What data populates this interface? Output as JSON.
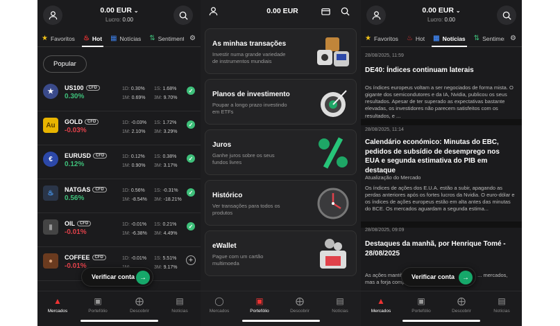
{
  "screen1": {
    "balance": "0.00 EUR",
    "profit_label": "Lucro:",
    "profit_value": "0.00",
    "tabs": [
      {
        "icon": "star-icon",
        "label": "Favoritos"
      },
      {
        "icon": "flame-icon",
        "label": "Hot"
      },
      {
        "icon": "news-icon",
        "label": "Notícias"
      },
      {
        "icon": "sentiment-icon",
        "label": "Sentimento"
      }
    ],
    "filter_pill": "Popular",
    "instruments": [
      {
        "symbol": "US100",
        "badge": "CFD",
        "change": "0.30%",
        "d1": "0.30%",
        "w1": "1.68%",
        "m1": "0.69%",
        "m3": "9.70%",
        "added": true,
        "logo": "us-flag"
      },
      {
        "symbol": "GOLD",
        "badge": "CFD",
        "change": "-0.03%",
        "d1": "-0.03%",
        "w1": "1.72%",
        "m1": "2.10%",
        "m3": "3.29%",
        "added": true,
        "logo": "Au"
      },
      {
        "symbol": "EURUSD",
        "badge": "CFD",
        "change": "0.12%",
        "d1": "0.12%",
        "w1": "0.38%",
        "m1": "0.90%",
        "m3": "3.17%",
        "added": true,
        "logo": "eu-us-flag"
      },
      {
        "symbol": "NATGAS",
        "badge": "CFD",
        "change": "0.56%",
        "d1": "0.56%",
        "w1": "-0.31%",
        "m1": "-8.54%",
        "m3": "-18.21%",
        "added": true,
        "logo": "flame"
      },
      {
        "symbol": "OIL",
        "badge": "CFD",
        "change": "-0.01%",
        "d1": "-0.01%",
        "w1": "0.21%",
        "m1": "-6.38%",
        "m3": "4.49%",
        "added": true,
        "logo": "barrel"
      },
      {
        "symbol": "COFFEE",
        "badge": "CFD",
        "change": "-0.01%",
        "d1": "-0.01%",
        "w1": "5.51%",
        "m1": "",
        "m3": "9.17%",
        "added": false,
        "logo": "coffee-bean"
      }
    ],
    "period_labels": {
      "d1": "1D:",
      "w1": "1S:",
      "m1": "1M:",
      "m3": "3M:"
    },
    "verify_button": "Verificar conta",
    "nav": [
      {
        "label": "Mercados",
        "icon": "markets-icon",
        "active": true
      },
      {
        "label": "Portefólio",
        "icon": "wallet-icon",
        "active": false
      },
      {
        "label": "Descobrir",
        "icon": "compass-icon",
        "active": false
      },
      {
        "label": "Notícias",
        "icon": "newspaper-icon",
        "active": false
      }
    ]
  },
  "screen2": {
    "balance": "0.00 EUR",
    "cards": [
      {
        "title": "As minhas transações",
        "subtitle": "Investir numa grande variedade de instrumentos mundiais",
        "art": "stocks-art"
      },
      {
        "title": "Planos de investimento",
        "subtitle": "Poupar a longo prazo investindo em ETFs",
        "art": "target-art"
      },
      {
        "title": "Juros",
        "subtitle": "Ganhe juros sobre os seus fundos livres",
        "art": "percent-art"
      },
      {
        "title": "Histórico",
        "subtitle": "Ver transações para todos os produtos",
        "art": "clock-art"
      },
      {
        "title": "eWallet",
        "subtitle": "Pague com um cartão multimoeda",
        "art": "wallet-art"
      }
    ],
    "nav": [
      {
        "label": "Mercados",
        "icon": "markets-icon",
        "active": false
      },
      {
        "label": "Portefólio",
        "icon": "wallet-icon",
        "active": true
      },
      {
        "label": "Descobrir",
        "icon": "compass-icon",
        "active": false
      },
      {
        "label": "Notícias",
        "icon": "newspaper-icon",
        "active": false
      }
    ]
  },
  "screen3": {
    "balance": "0.00 EUR",
    "profit_label": "Lucro:",
    "profit_value": "0.00",
    "tabs": [
      {
        "icon": "star-icon",
        "label": "Favoritos"
      },
      {
        "icon": "flame-icon",
        "label": "Hot"
      },
      {
        "icon": "news-icon",
        "label": "Notícias"
      },
      {
        "icon": "sentiment-icon",
        "label": "Sentimento"
      }
    ],
    "news": [
      {
        "date": "28/08/2025, 11:59",
        "title": "DE40: Índices continuam laterais",
        "body": "Os índices europeus voltam a ser negociados de forma mista. O gigante dos semicondutores e da IA, Nvidia, publicou os seus resultados. Apesar de ter superado as expectativas bastante elevadas, os investidores não parecem satisfeitos com os resultados, e ..."
      },
      {
        "date": "28/08/2025, 11:14",
        "title": "Calendário económico: Minutas do EBC, pedidos de subsídio de desemprego nos EUA e segunda estimativa do PIB em destaque",
        "subhead": "Atualização do Mercado",
        "body": "Os índices de ações dos E.U.A. estão a subir, apagando as perdas anteriores após os fortes lucros da Nvidia. O euro-dólar e os índices de ações europeus estão em alta antes das minutas do BCE. Os mercados aguardam a segunda estima..."
      },
      {
        "date": "28/08/2025, 09:09",
        "title": "Destaques da manhã, por Henrique Tomé - 28/08/2025",
        "body": "As ações mantê... vendas mais fracas da Nvidia ... mercados, mas a forja comprador... e a valorizar"
      }
    ],
    "verify_button": "Verificar conta",
    "nav": [
      {
        "label": "Mercados",
        "icon": "markets-icon",
        "active": true
      },
      {
        "label": "Portefólio",
        "icon": "wallet-icon",
        "active": false
      },
      {
        "label": "Descobrir",
        "icon": "compass-icon",
        "active": false
      },
      {
        "label": "Notícias",
        "icon": "newspaper-icon",
        "active": false
      }
    ]
  }
}
